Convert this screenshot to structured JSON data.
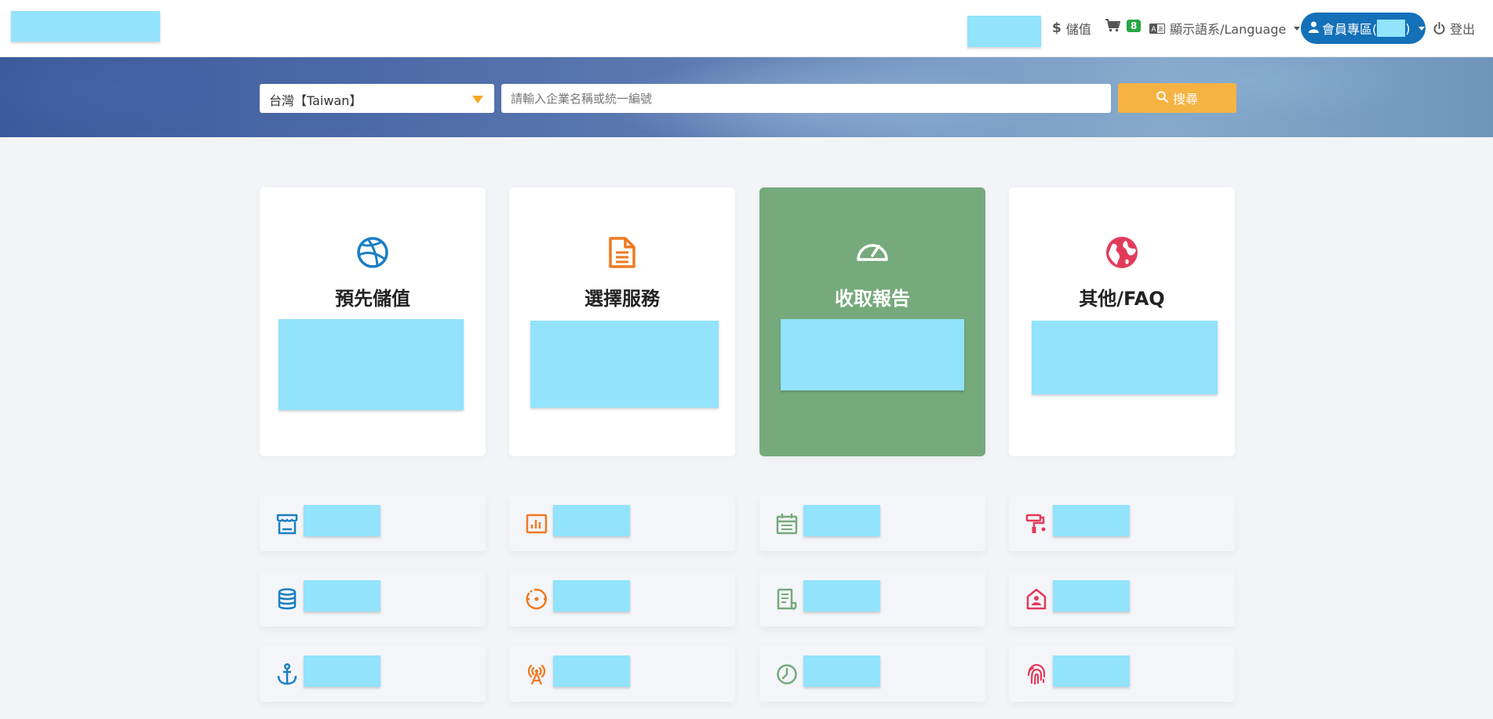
{
  "topbar": {
    "deposit_label": "儲值",
    "cart_count": "8",
    "language_label": "顯示語系/Language",
    "member_label": "會員專區(",
    "member_label_close": ")",
    "logout_label": "登出"
  },
  "search": {
    "country_value": "台灣【Taiwan】",
    "placeholder": "請輸入企業名稱或統一編號",
    "button_label": "搜尋"
  },
  "cards": [
    {
      "title": "預先儲值",
      "icon": "dribbble-icon",
      "color": "#1a7fc4"
    },
    {
      "title": "選擇服務",
      "icon": "document-icon",
      "color": "#ee7a22"
    },
    {
      "title": "收取報告",
      "icon": "speedometer-icon",
      "color": "#ffffff"
    },
    {
      "title": "其他/FAQ",
      "icon": "globe-icon",
      "color": "#e23b5a"
    }
  ],
  "tiles": [
    {
      "icon": "store-icon",
      "color": "#1a7fc4"
    },
    {
      "icon": "bar-chart-icon",
      "color": "#ee7a22"
    },
    {
      "icon": "calendar-icon",
      "color": "#76aa7c"
    },
    {
      "icon": "paint-roller-icon",
      "color": "#e23b5a"
    },
    {
      "icon": "database-icon",
      "color": "#1a7fc4"
    },
    {
      "icon": "target-icon",
      "color": "#ee7a22"
    },
    {
      "icon": "receipt-icon",
      "color": "#76aa7c"
    },
    {
      "icon": "house-user-icon",
      "color": "#e23b5a"
    },
    {
      "icon": "anchor-icon",
      "color": "#1a7fc4"
    },
    {
      "icon": "broadcast-tower-icon",
      "color": "#ee7a22"
    },
    {
      "icon": "chart-pie-icon",
      "color": "#76aa7c"
    },
    {
      "icon": "fingerprint-icon",
      "color": "#e23b5a"
    }
  ]
}
